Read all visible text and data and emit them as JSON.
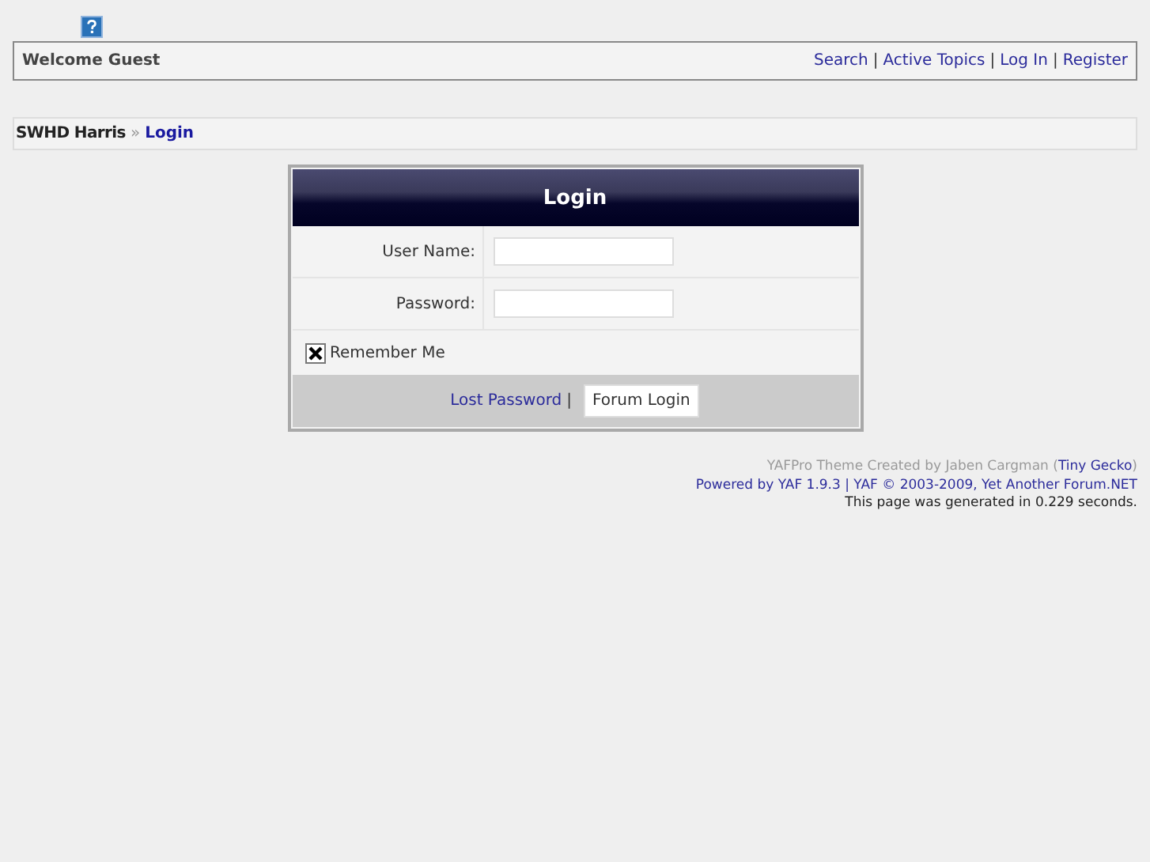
{
  "header": {
    "welcome": "Welcome Guest",
    "separator": "|",
    "links": [
      "Search",
      "Active Topics",
      "Log In",
      "Register"
    ]
  },
  "breadcrumb": {
    "separator": "»",
    "items": [
      {
        "label": "SWHD Harris",
        "kind": "text"
      },
      {
        "label": "Login",
        "kind": "link"
      }
    ]
  },
  "login": {
    "title": "Login",
    "fields": [
      {
        "label": "User Name:"
      },
      {
        "label": "Password:"
      }
    ],
    "remember": {
      "label": "Remember Me",
      "checked": true
    },
    "lost_password": "Lost Password",
    "separator": "|",
    "button": "Forum Login"
  },
  "footer": {
    "theme_text": "YAFPro Theme Created by Jaben Cargman (",
    "theme_link": "Tiny Gecko",
    "theme_close": ")",
    "powered": "Powered by YAF 1.9.3 | YAF © 2003-2009, Yet Another Forum.NET",
    "generated": "This page was generated in 0.229 seconds."
  }
}
